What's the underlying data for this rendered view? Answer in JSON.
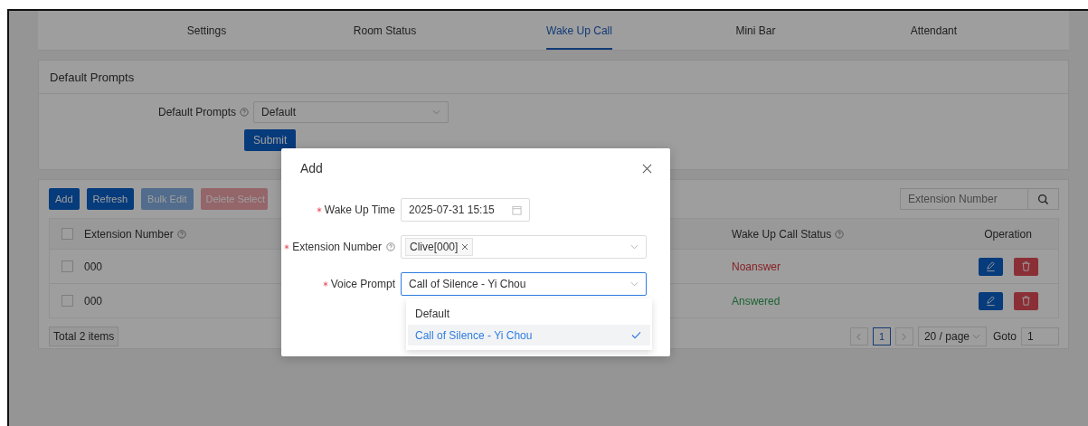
{
  "tabs": [
    {
      "label": "Settings",
      "selected": false
    },
    {
      "label": "Room Status",
      "selected": false
    },
    {
      "label": "Wake Up Call",
      "selected": true
    },
    {
      "label": "Mini Bar",
      "selected": false
    },
    {
      "label": "Attendant",
      "selected": false
    }
  ],
  "default_prompts": {
    "title": "Default Prompts",
    "label": "Default Prompts",
    "value": "Default",
    "submit": "Submit"
  },
  "toolbar": [
    {
      "label": "Add",
      "kind": "primary",
      "disabled": false
    },
    {
      "label": "Refresh",
      "kind": "primary",
      "disabled": false
    },
    {
      "label": "Bulk Edit",
      "kind": "primary",
      "disabled": true
    },
    {
      "label": "Delete Select",
      "kind": "danger",
      "disabled": true
    }
  ],
  "search": {
    "placeholder": "Extension Number"
  },
  "table": {
    "header_checked": false,
    "columns": [
      {
        "label": "Extension Number",
        "help": true
      },
      {
        "label": "Wake Up Call Status",
        "help": true
      },
      {
        "label": "Operation",
        "help": false
      }
    ],
    "rows": [
      {
        "checked": false,
        "extension": "000",
        "status": "Noanswer",
        "kind": "failed"
      },
      {
        "checked": false,
        "extension": "000",
        "status": "Answered",
        "kind": "success"
      }
    ]
  },
  "pagination": {
    "total": "Total 2 items",
    "page": "1",
    "page_size": "20 / page",
    "goto_label": "Goto",
    "goto_value": "1"
  },
  "modal": {
    "title": "Add",
    "fields": [
      {
        "label": "Wake Up Time",
        "required": true,
        "help": false,
        "kind": "date",
        "value": "2025-07-31 15:15",
        "focused": false
      },
      {
        "label": "Extension Number",
        "required": true,
        "help": true,
        "kind": "tags",
        "tags": [
          "Clive[000]"
        ],
        "focused": false
      },
      {
        "label": "Voice Prompt",
        "required": true,
        "help": false,
        "kind": "select",
        "value": "Call of Silence - Yi Chou",
        "focused": true
      }
    ],
    "options": [
      {
        "label": "Default",
        "selected": false
      },
      {
        "label": "Call of Silence - Yi Chou",
        "selected": true
      }
    ]
  }
}
